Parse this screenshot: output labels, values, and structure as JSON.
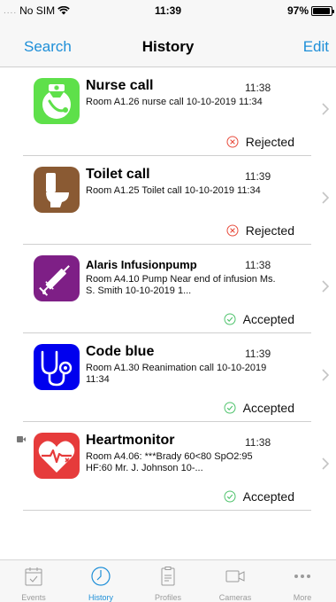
{
  "status_bar": {
    "carrier": "No SIM",
    "time": "11:39",
    "battery": "97%"
  },
  "nav": {
    "left": "Search",
    "title": "History",
    "right": "Edit"
  },
  "rows": [
    {
      "title": "Nurse call",
      "time": "11:38",
      "description": "Room A1.26 nurse call 10-10-2019 11:34",
      "status": "Rejected",
      "icon": "nurse-call-icon",
      "icon_color": "#5ee04a"
    },
    {
      "title": "Toilet call",
      "time": "11:39",
      "description": "Room A1.25 Toilet call 10-10-2019 11:34",
      "status": "Rejected",
      "icon": "toilet-icon",
      "icon_color": "#8a5a33"
    },
    {
      "title": "Alaris Infusionpump",
      "time": "11:38",
      "description": "Room A4.10 Pump Near end of infusion Ms. S. Smith 10-10-2019 1...",
      "status": "Accepted",
      "icon": "syringe-icon",
      "icon_color": "#7e1f86"
    },
    {
      "title": "Code blue",
      "time": "11:39",
      "description": "Room A1.30 Reanimation call 10-10-2019 11:34",
      "status": "Accepted",
      "icon": "stethoscope-icon",
      "icon_color": "#0000ee"
    },
    {
      "title": "Heartmonitor",
      "time": "11:38",
      "description": "Room A4.06: ***Brady 60<80 SpO2:95 HF:60 Mr. J. Johnson 10-...",
      "status": "Accepted",
      "icon": "heart-monitor-icon",
      "icon_color": "#e63b3b"
    }
  ],
  "tabs": [
    {
      "label": "Events",
      "icon": "events-icon"
    },
    {
      "label": "History",
      "icon": "clock-icon",
      "active": true
    },
    {
      "label": "Profiles",
      "icon": "clipboard-icon"
    },
    {
      "label": "Cameras",
      "icon": "camera-icon"
    },
    {
      "label": "More",
      "icon": "more-icon"
    }
  ]
}
